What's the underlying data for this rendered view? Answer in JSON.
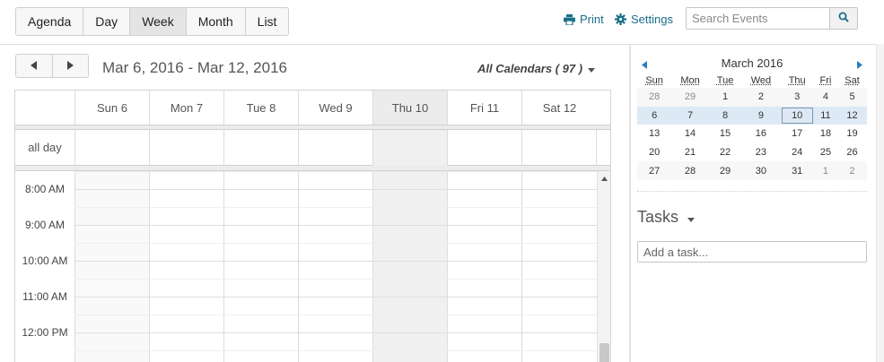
{
  "toolbar": {
    "views": [
      {
        "label": "Agenda",
        "active": false
      },
      {
        "label": "Day",
        "active": false
      },
      {
        "label": "Week",
        "active": true
      },
      {
        "label": "Month",
        "active": false
      },
      {
        "label": "List",
        "active": false
      }
    ],
    "print_label": "Print",
    "settings_label": "Settings",
    "search_placeholder": "Search Events",
    "icons": {
      "print": "print-icon",
      "settings": "gear-icon",
      "search": "search-icon"
    }
  },
  "calendar": {
    "range_title": "Mar 6, 2016 - Mar 12, 2016",
    "all_calendars_label": "All Calendars ( 97 )",
    "all_day_label": "all day",
    "days": [
      {
        "label": "Sun 6",
        "today": false
      },
      {
        "label": "Mon 7",
        "today": false
      },
      {
        "label": "Tue 8",
        "today": false
      },
      {
        "label": "Wed 9",
        "today": false
      },
      {
        "label": "Thu 10",
        "today": true
      },
      {
        "label": "Fri 11",
        "today": false
      },
      {
        "label": "Sat 12",
        "today": false
      }
    ],
    "time_slots": [
      "8:00 AM",
      "9:00 AM",
      "10:00 AM",
      "11:00 AM",
      "12:00 PM"
    ]
  },
  "mini_calendar": {
    "title": "March 2016",
    "weekday_headers": [
      "Sun",
      "Mon",
      "Tue",
      "Wed",
      "Thu",
      "Fri",
      "Sat"
    ],
    "weeks": [
      [
        "28",
        "29",
        "1",
        "2",
        "3",
        "4",
        "5"
      ],
      [
        "6",
        "7",
        "8",
        "9",
        "10",
        "11",
        "12"
      ],
      [
        "13",
        "14",
        "15",
        "16",
        "17",
        "18",
        "19"
      ],
      [
        "20",
        "21",
        "22",
        "23",
        "24",
        "25",
        "26"
      ],
      [
        "27",
        "28",
        "29",
        "30",
        "31",
        "1",
        "2"
      ]
    ],
    "selected_week_index": 1,
    "today_day": "10"
  },
  "tasks": {
    "title": "Tasks",
    "input_placeholder": "Add a task..."
  },
  "colors": {
    "accent_link": "#1a6e8a",
    "selected_week": "#dde9f5",
    "today_column": "#f0f0f0",
    "nav_arrow": "#2a7fc1"
  }
}
